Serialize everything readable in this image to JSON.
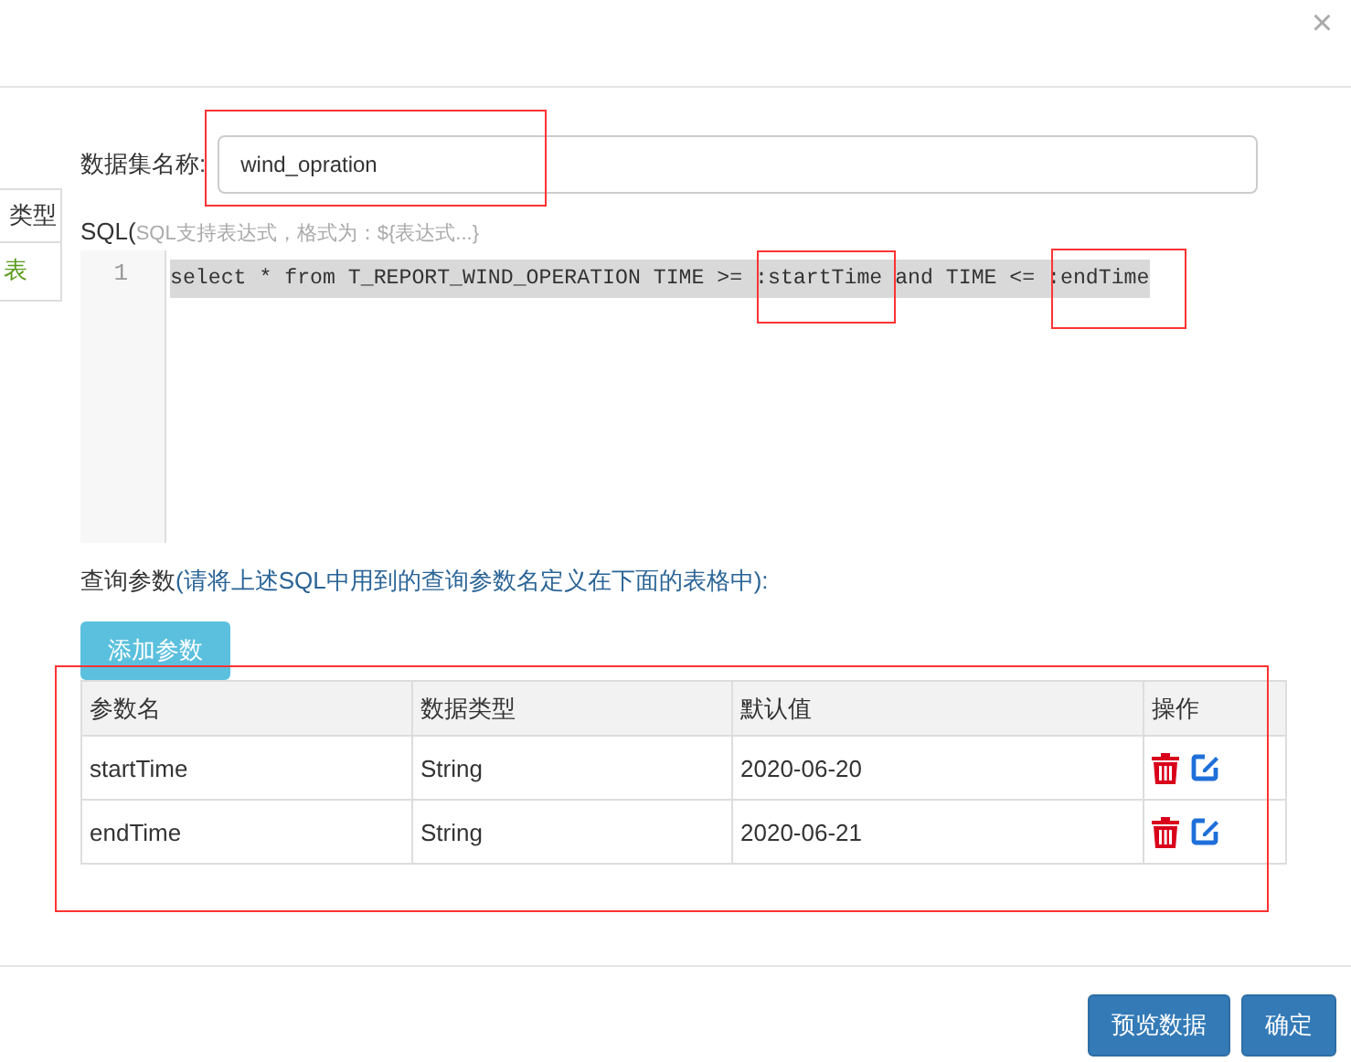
{
  "dialog": {
    "close": "×"
  },
  "side_table": {
    "header": "类型",
    "cell": "表"
  },
  "form": {
    "name_label": "数据集名称:",
    "name_value": "wind_opration",
    "sql_label": "SQL(",
    "sql_hint": "SQL支持表达式，格式为：${表达式...}",
    "sql_lines": [
      {
        "number": "1",
        "code": "select * from T_REPORT_WIND_OPERATION TIME >= :startTime and TIME <= :endTime"
      }
    ]
  },
  "params": {
    "label": "查询参数",
    "hint": "(请将上述SQL中用到的查询参数名定义在下面的表格中):",
    "add_button": "添加参数",
    "columns": [
      "参数名",
      "数据类型",
      "默认值",
      "操作"
    ],
    "rows": [
      {
        "name": "startTime",
        "type": "String",
        "default": "2020-06-20"
      },
      {
        "name": "endTime",
        "type": "String",
        "default": "2020-06-21"
      }
    ]
  },
  "buttons": [
    {
      "label": "预览数据"
    },
    {
      "label": "确定"
    }
  ]
}
